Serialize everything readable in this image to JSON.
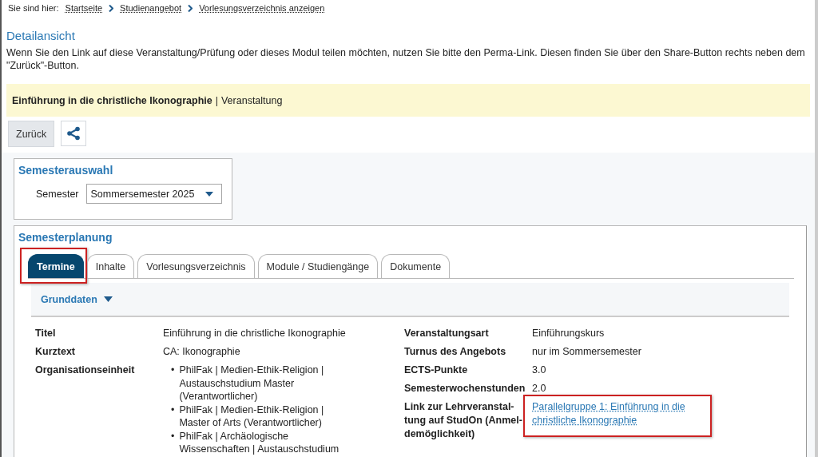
{
  "breadcrumb": {
    "label": "Sie sind hier:",
    "items": [
      "Startseite",
      "Studienangebot",
      "Vorlesungsverzeichnis anzeigen"
    ]
  },
  "heading": "Detailansicht",
  "intro": "Wenn Sie den Link auf diese Veranstaltung/Prüfung oder dieses Modul teilen möchten, nutzen Sie bitte den Perma-Link. Diesen finden Sie über den Share-Button rechts neben dem \"Zurück\"-Button.",
  "title_bar": {
    "title": "Einführung in die christliche Ikonographie",
    "separator": "|",
    "type": "Veranstaltung"
  },
  "buttons": {
    "back": "Zurück"
  },
  "semester_selection": {
    "title": "Semesterauswahl",
    "label": "Semester",
    "value": "Sommersemester 2025"
  },
  "semester_planning": {
    "title": "Semesterplanung",
    "tabs": [
      {
        "label": "Termine",
        "selected": true,
        "highlighted": true
      },
      {
        "label": "Inhalte",
        "selected": false,
        "highlighted": false
      },
      {
        "label": "Vorlesungsverzeichnis",
        "selected": false,
        "highlighted": false
      },
      {
        "label": "Module / Studiengänge",
        "selected": false,
        "highlighted": false
      },
      {
        "label": "Dokumente",
        "selected": false,
        "highlighted": false
      }
    ],
    "section": {
      "title": "Grunddaten",
      "expanded": true
    },
    "left_fields": [
      {
        "label": "Titel",
        "kind": "text",
        "value": "Einführung in die christliche Ikonographie"
      },
      {
        "label": "Kurztext",
        "kind": "text",
        "value": "CA: Ikonographie"
      },
      {
        "label": "Organisationseinheit",
        "kind": "list",
        "items": [
          {
            "bullet": "•",
            "text": "PhilFak | Medien-Ethik-Religion | Austauschstudium Master (Verantwortlicher)"
          },
          {
            "bullet": "•",
            "text": "PhilFak | Medien-Ethik-Religion | Master of Arts (Verantwortlicher)"
          },
          {
            "bullet": "•",
            "text": "PhilFak | Archäologische Wissenschaften | Austauschstudium"
          }
        ]
      }
    ],
    "right_fields": [
      {
        "label": "Veranstaltungsart",
        "kind": "text",
        "value": "Einführungskurs"
      },
      {
        "label": "Turnus des Angebots",
        "kind": "text",
        "value": "nur im Sommersemester"
      },
      {
        "label": "ECTS-Punkte",
        "kind": "text",
        "value": "3.0"
      },
      {
        "label": "Semesterwochenstunden",
        "kind": "text",
        "value": "2.0"
      },
      {
        "label": "Link zur Lehrveranstal-tung auf StudOn (Anmel-demöglichkeit)",
        "kind": "link",
        "value": "Parallelgruppe 1: Einführung in die christliche Ikonographie",
        "highlighted": true
      }
    ]
  }
}
